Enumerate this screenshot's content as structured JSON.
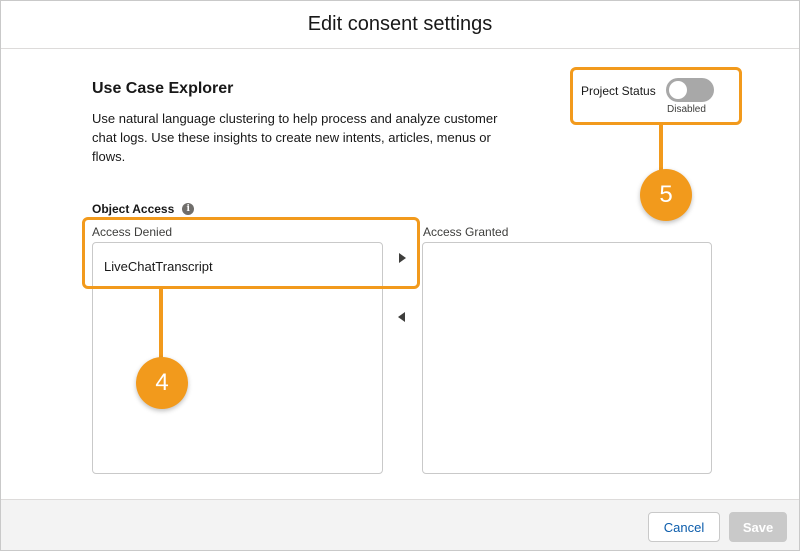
{
  "modal": {
    "title": "Edit consent settings"
  },
  "section": {
    "title": "Use Case Explorer",
    "description": "Use natural language clustering to help process and analyze customer chat logs. Use these insights to create new intents, articles, menus or flows."
  },
  "project_status": {
    "label": "Project Status",
    "state": "Disabled",
    "enabled": false
  },
  "object_access": {
    "label": "Object Access",
    "info_icon": "info-icon",
    "denied": {
      "label": "Access Denied",
      "items": [
        "LiveChatTranscript"
      ]
    },
    "granted": {
      "label": "Access Granted",
      "items": []
    }
  },
  "callouts": {
    "four": "4",
    "five": "5"
  },
  "footer": {
    "cancel_label": "Cancel",
    "save_label": "Save"
  },
  "colors": {
    "callout": "#f29a1c",
    "link": "#0b5cab",
    "toggle_off": "#a8a8a8"
  }
}
